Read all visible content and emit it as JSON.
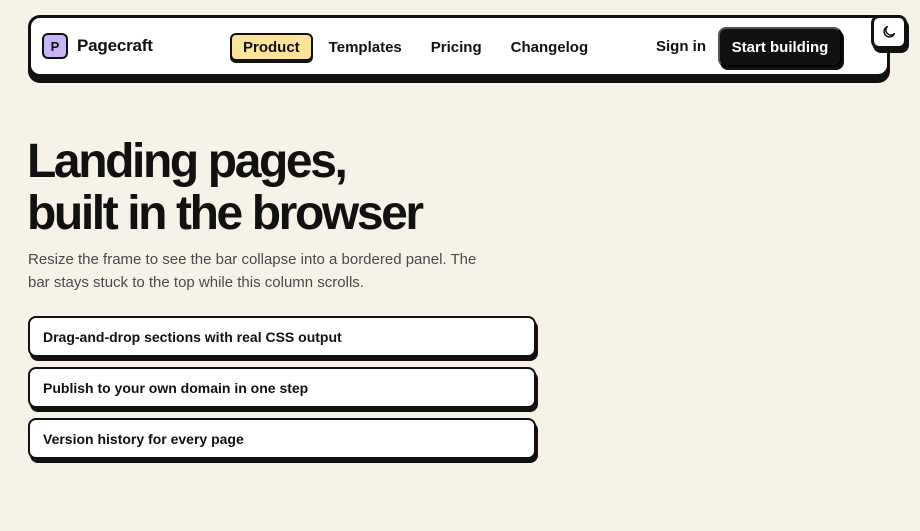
{
  "brand": {
    "mark": "P",
    "name": "Pagecraft",
    "mark_color": "#c6b4f5"
  },
  "nav": {
    "links": [
      {
        "label": "Product",
        "active": true
      },
      {
        "label": "Templates",
        "active": false
      },
      {
        "label": "Pricing",
        "active": false
      },
      {
        "label": "Changelog",
        "active": false
      }
    ],
    "signin_label": "Sign in",
    "cta_label": "Start building",
    "theme_toggle_icon": "moon-icon",
    "active_color": "#fde49a"
  },
  "hero": {
    "title_line1": "Landing pages,",
    "title_line2": "built in the browser",
    "subtitle": "Resize the frame to see the bar collapse into a bordered panel. The bar stays stuck to the top while this column scrolls."
  },
  "features": [
    "Drag-and-drop sections with real CSS output",
    "Publish to your own domain in one step",
    "Version history for every page"
  ],
  "colors": {
    "background": "#f7f2e8",
    "ink": "#111111",
    "surface": "#ffffff"
  }
}
